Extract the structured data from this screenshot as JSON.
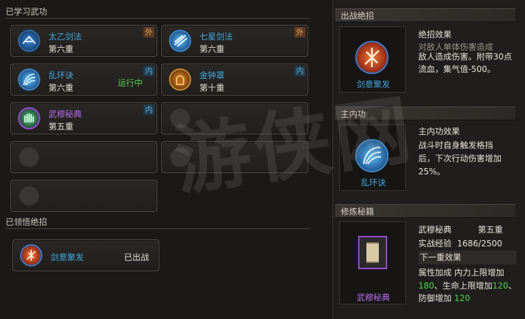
{
  "left": {
    "learned_title": "已学习武功",
    "skills": [
      {
        "name": "太乙剑法",
        "level": "第六重",
        "tag": "外",
        "tag_type": "out",
        "status": "",
        "name_color": "#3fa8e0",
        "icon": "sword-swirl-icon"
      },
      {
        "name": "七星剑法",
        "level": "第六重",
        "tag": "外",
        "tag_type": "out",
        "status": "",
        "name_color": "#3fa8e0",
        "icon": "seven-star-sword-icon"
      },
      {
        "name": "乱环诀",
        "level": "第六重",
        "tag": "内",
        "tag_type": "in",
        "status": "运行中",
        "name_color": "#3fa8e0",
        "icon": "wave-fan-icon"
      },
      {
        "name": "金钟罩",
        "level": "第十重",
        "tag": "内",
        "tag_type": "in",
        "status": "",
        "name_color": "#3fa8e0",
        "icon": "golden-bell-icon"
      },
      {
        "name": "武穆秘典",
        "level": "第五重",
        "tag": "内",
        "tag_type": "in",
        "status": "",
        "name_color": "#b66af0",
        "icon": "green-claw-icon"
      }
    ],
    "ultimate_title": "已领悟绝招",
    "ultimate": {
      "name": "剑意聚发",
      "status": "已出战",
      "icon": "burst-sword-icon"
    }
  },
  "right": {
    "ultimate_header": "出战绝招",
    "ultimate_effect_title": "绝招效果",
    "ultimate_effect_line1": "对敌人单体伤害造成",
    "ultimate_effect_line2": "敌人造成伤害。附带30点",
    "ultimate_effect_line3": "流血，集气值-500。",
    "ultimate_icon_label": "剑意聚发",
    "inner_header": "主内功",
    "inner_effect_title": "主内功效果",
    "inner_effect_line1": "战斗时自身触发格挡",
    "inner_effect_line2": "后，下次行动伤害增加",
    "inner_effect_line3": "25%。",
    "inner_icon_label": "乱环诀",
    "book_header": "修炼秘籍",
    "book_name": "武穆秘典",
    "book_level": "第五重",
    "exp_label": "实战经验",
    "exp_value": "1686/2500",
    "next_level_label": "下一重效果",
    "attr_line1_a": "属性加成  内力上限增加",
    "attr_line2_a": "180",
    "attr_line2_b": "、生命上限增加",
    "attr_line2_c": "120",
    "attr_line2_d": "、",
    "attr_line3_a": "防御增加",
    "attr_line3_b": "120",
    "book_icon_label": "武穆秘典"
  },
  "watermark": "游侠网"
}
